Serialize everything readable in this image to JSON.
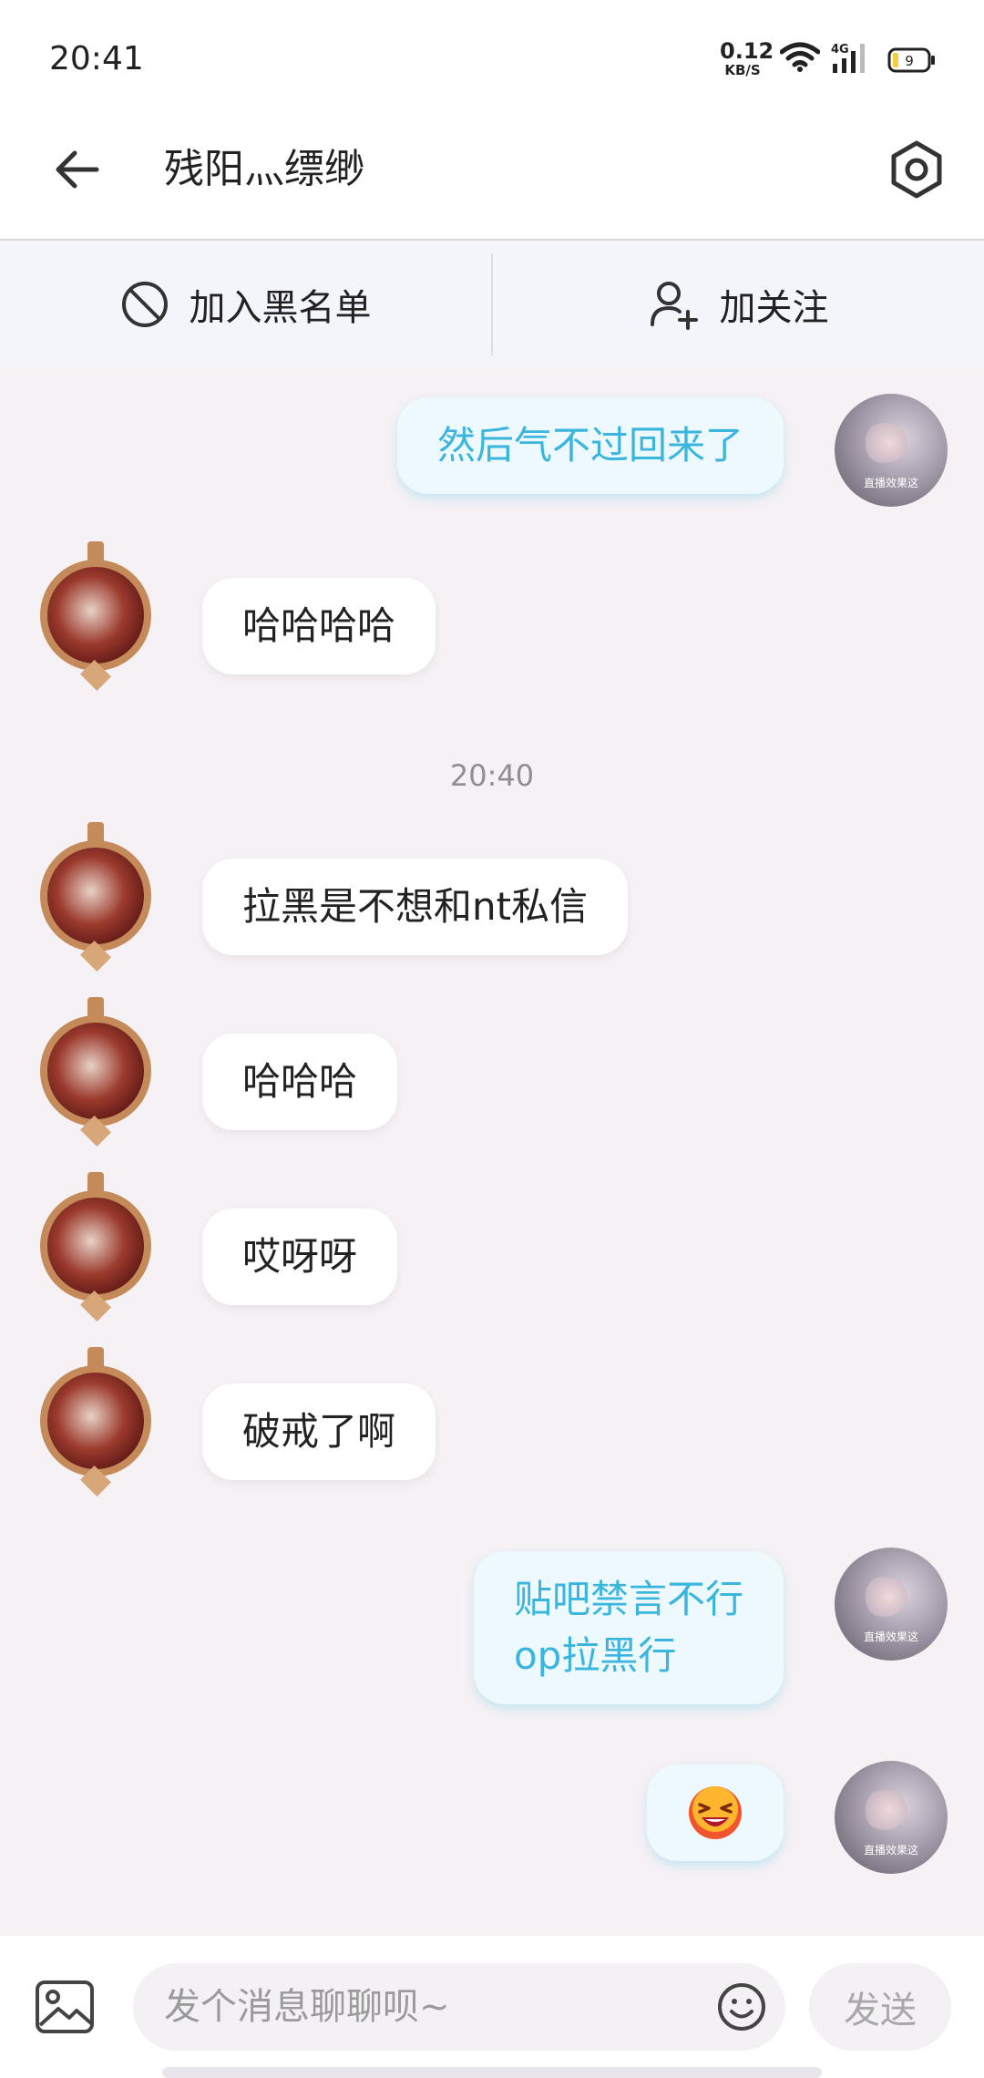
{
  "status_bar": {
    "time": "20:41",
    "net_speed_value": "0.12",
    "net_speed_unit": "KB/S",
    "network_type": "4G",
    "battery": "9"
  },
  "header": {
    "title": "残阳灬缥缈",
    "back_icon": "arrow-left-icon",
    "settings_icon": "gear-icon"
  },
  "actions": {
    "blacklist_label": "加入黑名单",
    "follow_label": "加关注"
  },
  "messages": [
    {
      "side": "self",
      "text": "然后气不过回来了"
    },
    {
      "side": "other",
      "text": "哈哈哈哈"
    },
    {
      "side": "time",
      "text": "20:40"
    },
    {
      "side": "other",
      "text": "拉黑是不想和nt私信"
    },
    {
      "side": "other",
      "text": "哈哈哈"
    },
    {
      "side": "other",
      "text": "哎呀呀"
    },
    {
      "side": "other",
      "text": "破戒了啊"
    },
    {
      "side": "self",
      "text_line1": "贴吧禁言不行",
      "text_line2": "op拉黑行"
    },
    {
      "side": "self",
      "emoji": "laughing-emoji"
    }
  ],
  "self_avatar_caption": "直播效果这",
  "composer": {
    "placeholder": "发个消息聊聊呗~",
    "send_label": "发送"
  },
  "colors": {
    "self_bubble_text": "#3ab5de",
    "self_bubble_bg": "#eef9fd",
    "chat_bg": "#f5f1f5"
  }
}
